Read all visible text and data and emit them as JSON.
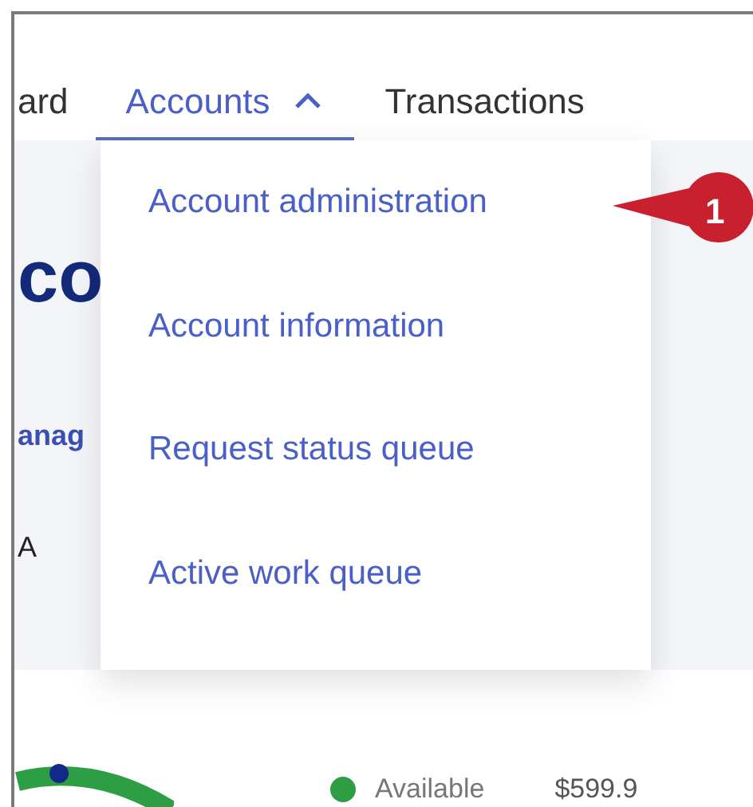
{
  "nav": {
    "tabs": [
      {
        "label": "ard",
        "selected": false
      },
      {
        "label": "Accounts",
        "selected": true,
        "expanded": true
      },
      {
        "label": "Transactions",
        "selected": false
      }
    ]
  },
  "dropdown": {
    "items": [
      "Account administration",
      "Account information",
      "Request status queue",
      "Active work queue"
    ]
  },
  "callout": {
    "label": "1"
  },
  "background": {
    "heading": "co",
    "link": "anag",
    "label": "A"
  },
  "summary": {
    "legend": [
      {
        "label": "Available",
        "value": "$599.9",
        "color": "#2e9e44"
      }
    ]
  }
}
